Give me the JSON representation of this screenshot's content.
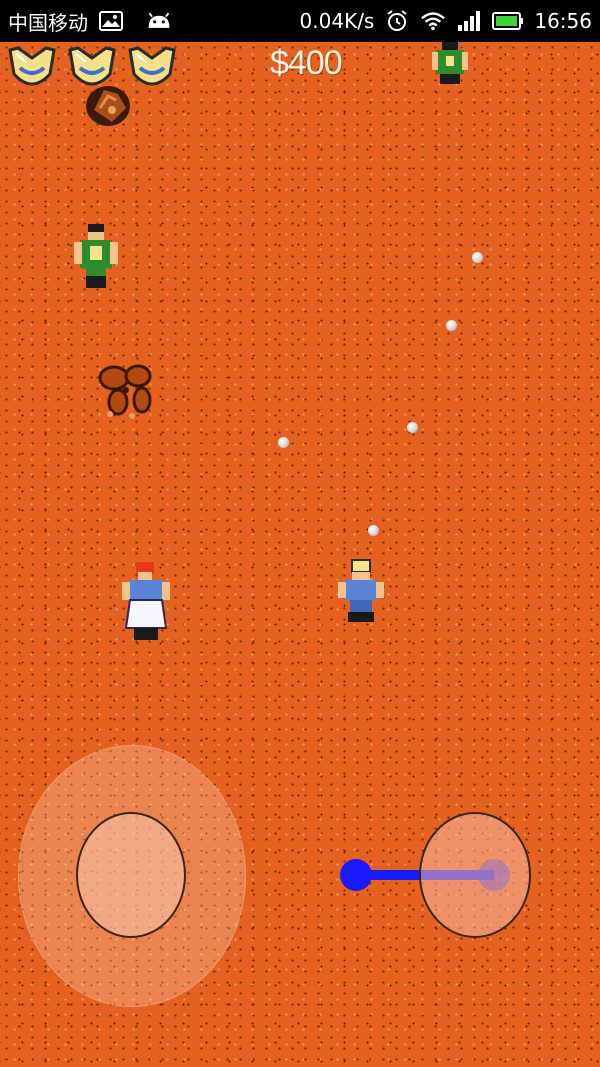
{
  "status_bar": {
    "carrier": "中国移动",
    "speed": "0.04K/s",
    "time": "16:56",
    "icons": [
      "image-icon",
      "android-icon",
      "alarm-icon",
      "wifi-icon",
      "signal-icon",
      "battery-icon"
    ]
  },
  "hud": {
    "money": "$400",
    "lives": 3
  },
  "colors": {
    "ground": "#e4611f",
    "aim": "#1a1aff",
    "enemy_shirt": "#2f8c2a",
    "player_shirt": "#5a84d6"
  },
  "sprites": [
    "lives-icon",
    "lives-icon",
    "lives-icon",
    "enemy-green",
    "enemy-green",
    "player-blue",
    "ally-white",
    "rocks",
    "bush",
    "bullet",
    "bullet",
    "bullet",
    "bullet",
    "bullet"
  ]
}
